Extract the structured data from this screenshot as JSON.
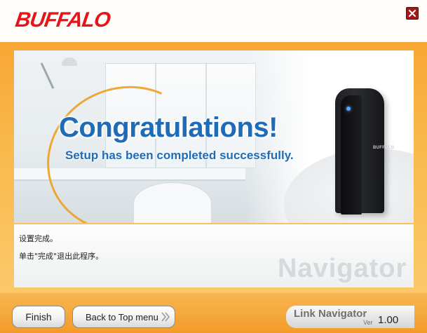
{
  "header": {
    "logo_text": "BUFFALO",
    "close_icon": "close-icon"
  },
  "hero": {
    "headline": "Congratulations!",
    "subline": "Setup has been completed successfully.",
    "device_brand": "BUFFALO"
  },
  "content": {
    "lines": [
      "设置完成。",
      "单击\"完成\"退出此程序。"
    ],
    "watermark": "Navigator"
  },
  "footer": {
    "finish_label": "Finish",
    "back_label": "Back to Top menu",
    "back_icon": "double-chevron-right-icon",
    "app_name": "Link Navigator",
    "version_prefix": "Ver",
    "version_number": "1.00"
  },
  "colors": {
    "brand_red": "#e4161b",
    "accent_orange": "#f7a733",
    "headline_blue": "#1f6bb5"
  }
}
